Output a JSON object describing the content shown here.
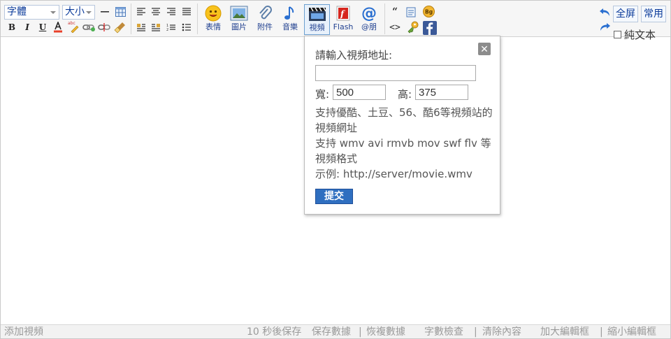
{
  "toolbar": {
    "font_select": "字體",
    "size_select": "大小",
    "emoji_label": "表情",
    "image_label": "圖片",
    "attach_label": "附件",
    "music_label": "音樂",
    "video_label": "視頻",
    "flash_label": "Flash",
    "at_label": "@朋",
    "fullscreen_label": "全屏",
    "common_label": "常用",
    "plaintext_label": "純文本",
    "bgcode_label": "Bg",
    "quote_glyph": "“",
    "code_glyph": "<>"
  },
  "video_popup": {
    "title": "請輸入視頻地址:",
    "url_value": "",
    "width_label": "寬:",
    "width_value": "500",
    "height_label": "高:",
    "height_value": "375",
    "help_line1": "支持優酷、土豆、56、酷6等視頻站的視頻網址",
    "help_line2": "支持 wmv avi rmvb mov swf flv 等視頻格式",
    "help_line3": "示例: http://server/movie.wmv",
    "submit_label": "提交",
    "close_glyph": "✕"
  },
  "statusbar": {
    "left_text": "添加視頻",
    "autosave_text": "10 秒後保存",
    "save_data": "保存數據",
    "sep1": "|",
    "restore_data": "恢複數據",
    "word_check": "字數檢查",
    "sep2": "|",
    "clear_content": "清除內容",
    "enlarge": "加大編輯框",
    "sep3": "|",
    "shrink": "縮小編輯框"
  },
  "colors": {
    "accent": "#2f6fc0",
    "toolbar_bg": "#f6f6f6",
    "link_blue": "#1f3f8f"
  }
}
